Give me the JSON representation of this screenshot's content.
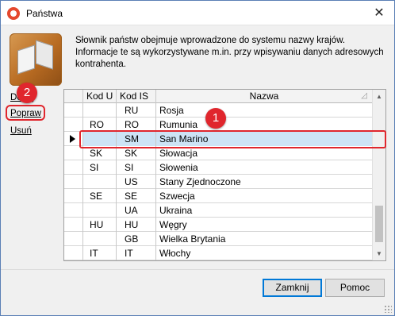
{
  "window": {
    "title": "Państwa",
    "close_glyph": "✕"
  },
  "icons": {
    "app": "app-logo-icon",
    "book": "address-book-icon",
    "close": "close-icon",
    "pointer": "row-pointer-icon",
    "colors": {
      "accent_red": "#e0262d",
      "selection": "#cde3f5"
    }
  },
  "description": "Słownik państw obejmuje wprowadzone do systemu nazwy krajów. Informacje te są wykorzystywane m.in. przy wpisywaniu danych adresowych kontrahenta.",
  "side_links": {
    "add": "Dodaj",
    "edit": "Popraw",
    "delete": "Usuń"
  },
  "badges": {
    "one": "1",
    "two": "2"
  },
  "grid": {
    "columns": {
      "code_u": "Kod U",
      "code_is": "Kod IS",
      "name": "Nazwa",
      "sort": "◿"
    },
    "rows": [
      {
        "kod_u": "",
        "kod_is": "RU",
        "name": "Rosja"
      },
      {
        "kod_u": "RO",
        "kod_is": "RO",
        "name": "Rumunia"
      },
      {
        "kod_u": "",
        "kod_is": "SM",
        "name": "San Marino",
        "selected": true
      },
      {
        "kod_u": "SK",
        "kod_is": "SK",
        "name": "Słowacja"
      },
      {
        "kod_u": "SI",
        "kod_is": "SI",
        "name": "Słowenia"
      },
      {
        "kod_u": "",
        "kod_is": "US",
        "name": "Stany Zjednoczone"
      },
      {
        "kod_u": "SE",
        "kod_is": "SE",
        "name": "Szwecja"
      },
      {
        "kod_u": "",
        "kod_is": "UA",
        "name": "Ukraina"
      },
      {
        "kod_u": "HU",
        "kod_is": "HU",
        "name": "Węgry"
      },
      {
        "kod_u": "",
        "kod_is": "GB",
        "name": "Wielka Brytania"
      },
      {
        "kod_u": "IT",
        "kod_is": "IT",
        "name": "Włochy"
      }
    ],
    "scrollbar": {
      "up": "▲",
      "down": "▼"
    }
  },
  "buttons": {
    "close": "Zamknij",
    "help": "Pomoc"
  }
}
